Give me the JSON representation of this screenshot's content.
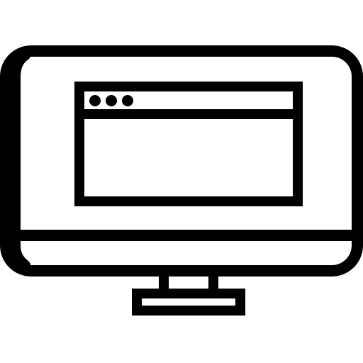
{
  "icon": {
    "name": "computer-monitor-with-browser-window-icon",
    "stroke_color": "#000000",
    "fill_color": "#ffffff"
  }
}
